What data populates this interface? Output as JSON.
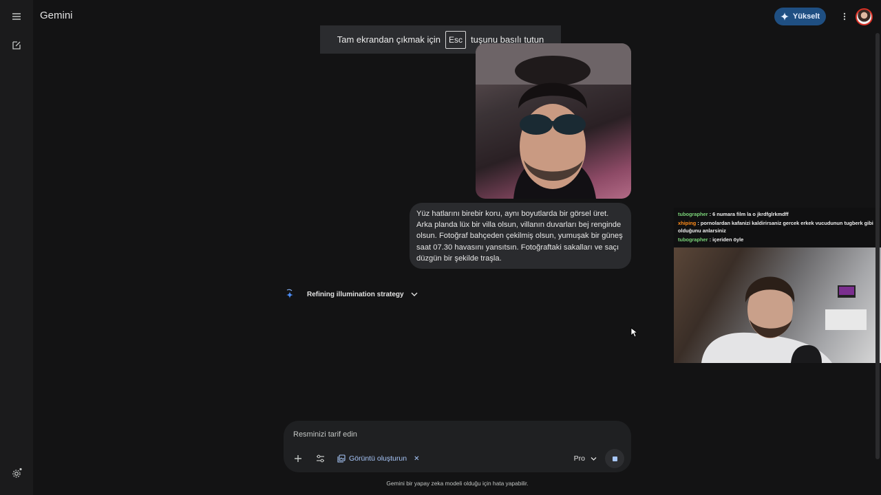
{
  "app": {
    "title": "Gemini"
  },
  "header": {
    "upgrade_label": "Yükselt"
  },
  "fullscreen_notice": {
    "before": "Tam ekrandan çıkmak için",
    "key": "Esc",
    "after": "tuşunu basılı tutun"
  },
  "conversation": {
    "user_message": "Yüz hatlarını birebir koru, aynı boyutlarda bir görsel üret. Arka planda lüx bir villa olsun, villanın duvarları bej renginde olsun. Fotoğraf bahçeden çekilmiş olsun, yumuşak bir güneş saat 07.30 havasını yansıtsın. Fotoğraftaki sakalları ve saçı düzgün bir şekilde traşla.",
    "thinking_status": "Refining illumination strategy"
  },
  "stream_chat": [
    {
      "user": "tubographer",
      "sep": " : ",
      "text": "6 numara film la o jkrdfglrkmdff"
    },
    {
      "user": "xhiping",
      "sep": " : ",
      "text": "pornolardan kafanizi kaldirirsaniz gercek erkek vucudunun tugberk gibi olduğunu anlarsiniz"
    },
    {
      "user": "tubographer",
      "sep": " : ",
      "text": "içeriden öyle"
    }
  ],
  "composer": {
    "placeholder": "Resminizi tarif edin",
    "tool_label": "Görüntü oluşturun",
    "tool_remove": "✕",
    "model": "Pro"
  },
  "footer": {
    "disclaimer": "Gemini bir yapay zeka modeli olduğu için hata yapabilir."
  },
  "colors": {
    "background": "#131314",
    "accent": "#a8c7fa",
    "upgrade_button": "#1f4f82"
  }
}
